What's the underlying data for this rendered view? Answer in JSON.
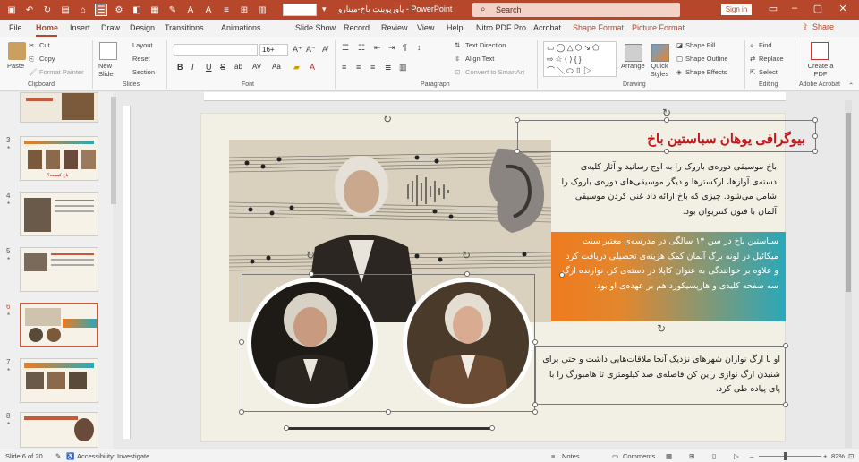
{
  "title_bar": {
    "document_title": "پاورپوینت باخ-مینارو",
    "app_name": "PowerPoint",
    "search_placeholder": "Search",
    "sign_in_label": "Sign in",
    "accent_color": "#b7472a"
  },
  "menu": {
    "tabs": [
      "File",
      "Home",
      "Insert",
      "Draw",
      "Design",
      "Transitions",
      "Animations",
      "Slide Show",
      "Record",
      "Review",
      "View",
      "Help",
      "Nitro PDF Pro",
      "Acrobat",
      "Shape Format",
      "Picture Format"
    ],
    "active_tab": "Home",
    "share_label": "Share"
  },
  "ribbon": {
    "clipboard": {
      "paste": "Paste",
      "cut": "Cut",
      "copy": "Copy",
      "format_painter": "Format Painter",
      "group_label": "Clipboard"
    },
    "slides": {
      "new_slide": "New Slide",
      "layout": "Layout",
      "reset": "Reset",
      "section": "Section",
      "group_label": "Slides"
    },
    "font": {
      "font_size": "16+",
      "group_label": "Font",
      "bold": "B",
      "italic": "I",
      "underline": "U",
      "strike": "S",
      "shadow": "ab",
      "spacing": "AV",
      "case": "Aa"
    },
    "paragraph": {
      "text_direction": "Text Direction",
      "align_text": "Align Text",
      "convert_smartart": "Convert to SmartArt",
      "group_label": "Paragraph"
    },
    "drawing": {
      "arrange": "Arrange",
      "quick_styles": "Quick Styles",
      "shape_fill": "Shape Fill",
      "shape_outline": "Shape Outline",
      "shape_effects": "Shape Effects",
      "group_label": "Drawing"
    },
    "editing": {
      "find": "Find",
      "replace": "Replace",
      "select": "Select",
      "group_label": "Editing"
    },
    "adobe": {
      "create_pdf": "Create a PDF",
      "group_label": "Adobe Acrobat"
    }
  },
  "thumbnails": {
    "items": [
      {
        "number": "",
        "star": ""
      },
      {
        "number": "3",
        "star": "*"
      },
      {
        "number": "4",
        "star": "*"
      },
      {
        "number": "5",
        "star": "*"
      },
      {
        "number": "6",
        "star": "*"
      },
      {
        "number": "7",
        "star": "*"
      },
      {
        "number": "8",
        "star": "*"
      }
    ],
    "selected_number": "6",
    "thumb3_caption": "باخ کیست؟"
  },
  "slide": {
    "title": "بیوگرافی یوهان سباستین باخ",
    "paragraph1": "باخ موسیقی دوره‌ی باروک را به اوج رسانید و آثار کلیه‌ی دسته‌ی آوازها، ارکسترها و دیگر موسیقی‌های دوره‌ی باروک را شامل می‌شود. چیزی که باخ ارائه داد غنی کردن موسیقی آلمان با فنون کنتریوان بود.",
    "paragraph2": "سباستین باخ در سن ۱۴ سالگی در مدرسه‌ی معتبر سنت میکائیل در لونه برگ آلمان کمک هزینه‌ی تحصیلی دریافت کرد و علاوه بر خوانندگی به عنوان کاپلا در دسته‌ی کر، نوازنده ارگ سه صفحه کلیدی و هارپسیکورد هم بر عهده‌ی او بود.",
    "paragraph3": "او با ارگ نوازان شهرهای نزدیک آنجا ملاقات‌هایی داشت و حتی برای شنیدن ارگ نوازی راین کن فاصله‌ی صد کیلومتری تا هامبورگ را با پای پیاده طی کرد.",
    "title_color": "#c4161c",
    "gradient_colors": [
      "#f07a1e",
      "#2aa8b9"
    ]
  },
  "status_bar": {
    "slide_info": "Slide 6 of 20",
    "accessibility": "Accessibility: Investigate",
    "notes": "Notes",
    "comments": "Comments",
    "zoom": "82%"
  }
}
